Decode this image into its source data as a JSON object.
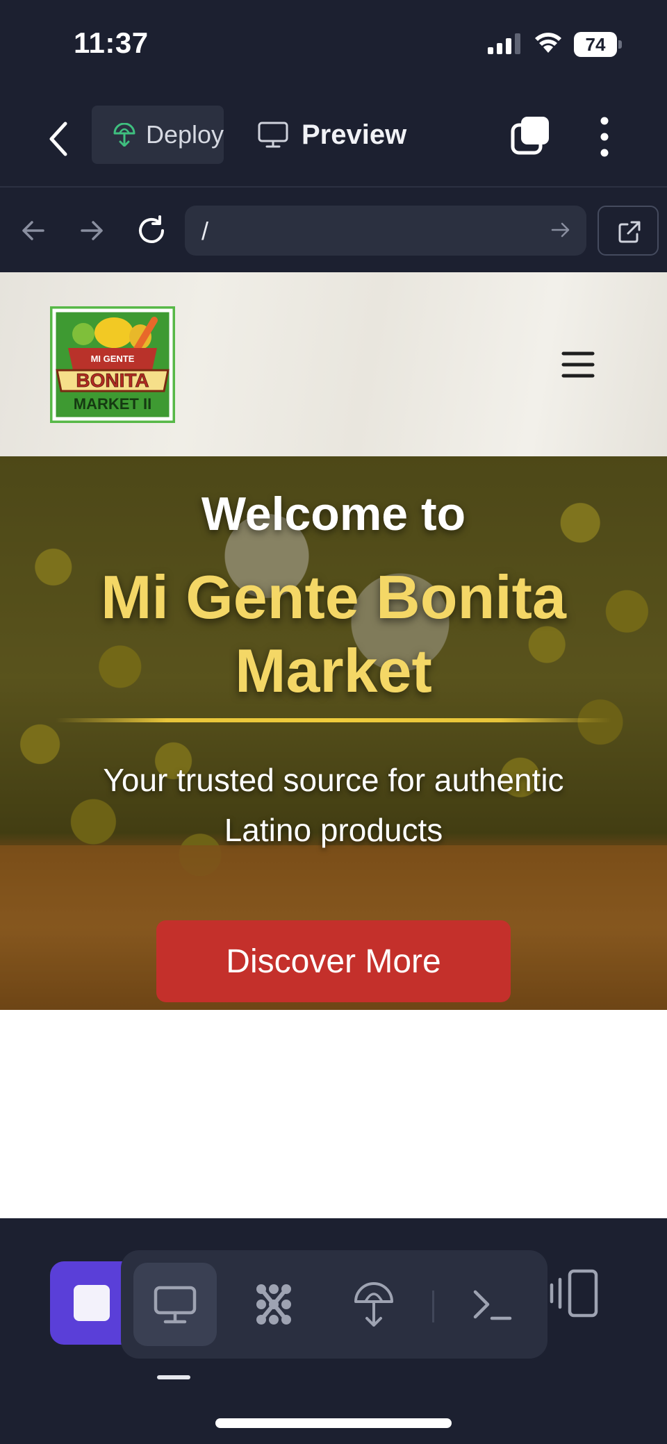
{
  "status_bar": {
    "time": "11:37",
    "battery_level": "74",
    "icons": [
      "signal-icon",
      "wifi-icon",
      "battery-icon"
    ]
  },
  "app_bar": {
    "tabs": [
      {
        "label": "Deploy",
        "icon": "deploy-icon",
        "active": false
      },
      {
        "label": "Preview",
        "icon": "monitor-icon",
        "active": true
      }
    ],
    "icons": [
      "back-icon",
      "tabs-icon",
      "more-icon"
    ]
  },
  "browser": {
    "url": "/",
    "icons": [
      "nav-back-icon",
      "nav-forward-icon",
      "reload-icon",
      "url-go-icon",
      "open-external-icon"
    ]
  },
  "site": {
    "logo": {
      "line1": "MI GENTE",
      "line2": "BONITA",
      "line3": "MARKET II"
    },
    "hero": {
      "welcome": "Welcome to",
      "title": "Mi Gente Bonita Market",
      "subtitle": "Your trusted source for authentic Latino products",
      "cta_label": "Discover More"
    }
  },
  "bottom_toolbar": {
    "tools": [
      {
        "name": "preview",
        "icon": "monitor-icon",
        "active": true
      },
      {
        "name": "agent",
        "icon": "agent-icon",
        "active": false
      },
      {
        "name": "deploy",
        "icon": "deploy-icon",
        "active": false
      },
      {
        "name": "shell",
        "icon": "terminal-icon",
        "active": false
      },
      {
        "name": "devices",
        "icon": "devices-icon",
        "active": false
      }
    ]
  },
  "colors": {
    "background": "#1c2030",
    "stop_button": "#5a3fd8",
    "hero_title": "#f4d766",
    "cta": "#c4302b",
    "deploy_accent": "#3fbf7f"
  }
}
